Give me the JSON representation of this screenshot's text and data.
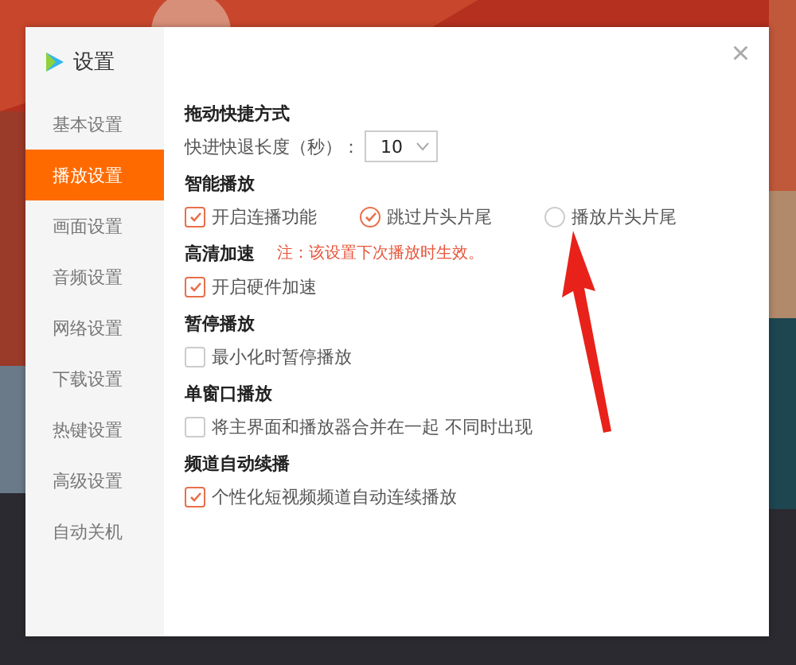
{
  "dialog": {
    "title": "设置",
    "close": "×"
  },
  "sidebar": {
    "items": [
      {
        "label": "基本设置",
        "selected": false
      },
      {
        "label": "播放设置",
        "selected": true
      },
      {
        "label": "画面设置",
        "selected": false
      },
      {
        "label": "音频设置",
        "selected": false
      },
      {
        "label": "网络设置",
        "selected": false
      },
      {
        "label": "下载设置",
        "selected": false
      },
      {
        "label": "热键设置",
        "selected": false
      },
      {
        "label": "高级设置",
        "selected": false
      },
      {
        "label": "自动关机",
        "selected": false
      }
    ]
  },
  "sections": [
    {
      "title": "拖动快捷方式",
      "field": {
        "label": "快进快退长度（秒）：",
        "value": "10"
      }
    },
    {
      "title": "智能播放",
      "options": [
        {
          "kind": "checkbox",
          "label": "开启连播功能",
          "checked": true
        },
        {
          "kind": "radio",
          "label": "跳过片头片尾",
          "selected": true
        },
        {
          "kind": "radio",
          "label": "播放片头片尾",
          "selected": false
        }
      ]
    },
    {
      "title": "高清加速",
      "note": "注：该设置下次播放时生效。",
      "options": [
        {
          "kind": "checkbox",
          "label": "开启硬件加速",
          "checked": true
        }
      ]
    },
    {
      "title": "暂停播放",
      "options": [
        {
          "kind": "checkbox",
          "label": "最小化时暂停播放",
          "checked": false
        }
      ]
    },
    {
      "title": "单窗口播放",
      "options": [
        {
          "kind": "checkbox",
          "label": "将主界面和播放器合并在一起 不同时出现",
          "checked": false
        }
      ]
    },
    {
      "title": "频道自动续播",
      "options": [
        {
          "kind": "checkbox",
          "label": "个性化短视频频道自动连续播放",
          "checked": true
        }
      ]
    }
  ]
}
